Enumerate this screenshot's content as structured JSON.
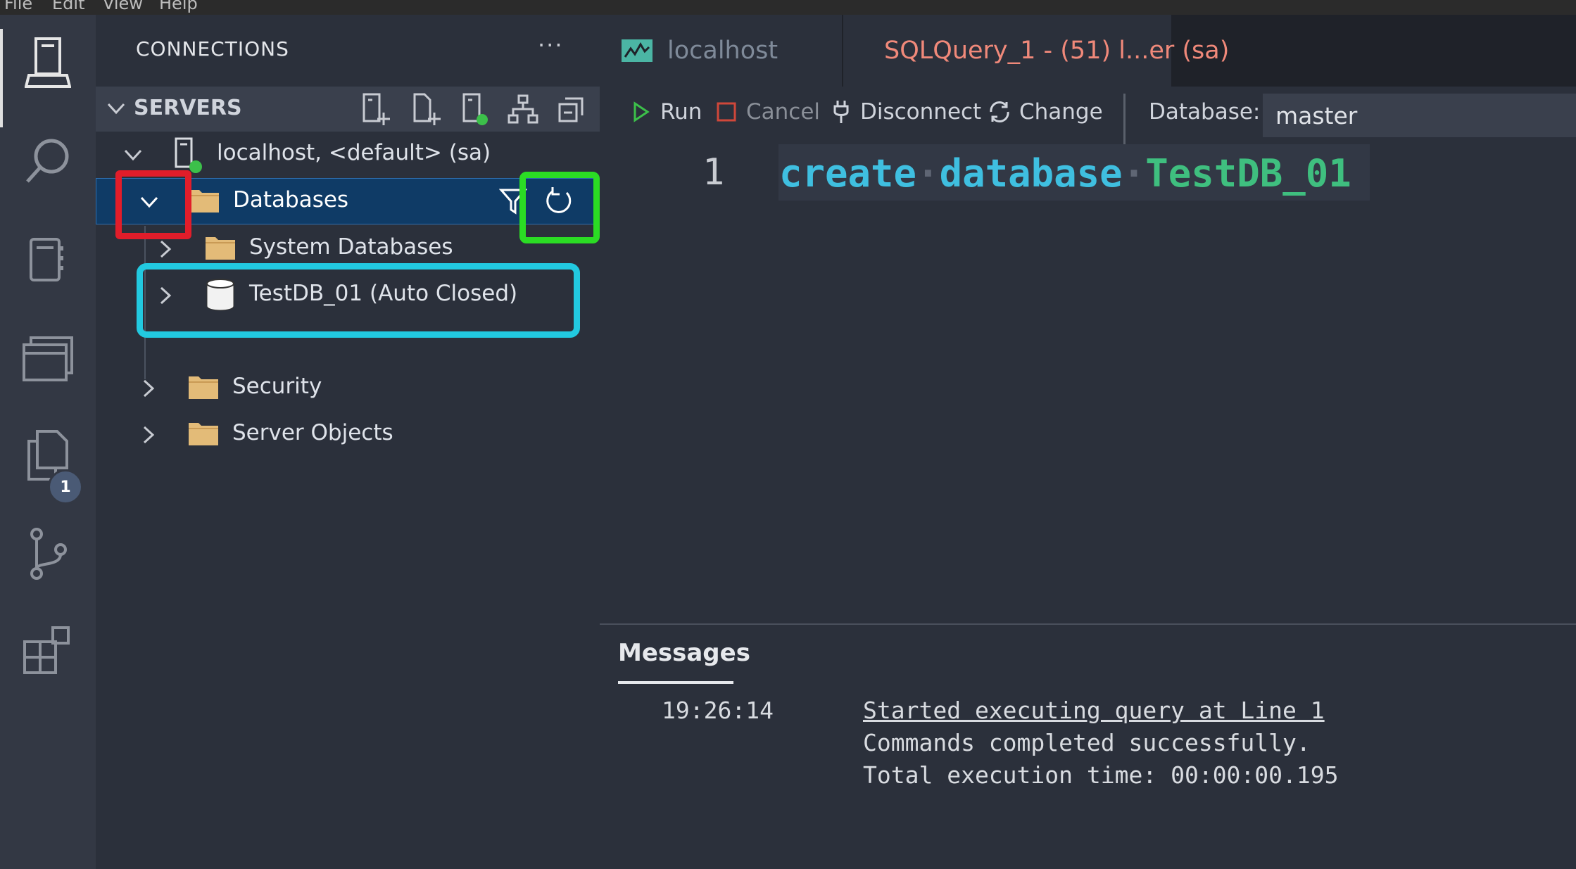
{
  "menu": {
    "items": [
      "File",
      "Edit",
      "View",
      "Help"
    ]
  },
  "activity_bar": {
    "badge_count": "1"
  },
  "sidebar": {
    "title": "CONNECTIONS",
    "more": "···",
    "servers_label": "SERVERS",
    "tree": {
      "server": "localhost, <default> (sa)",
      "databases": "Databases",
      "system_databases": "System Databases",
      "testdb": "TestDB_01 (Auto Closed)",
      "security": "Security",
      "server_objects": "Server Objects"
    }
  },
  "tabs": [
    {
      "label": "localhost",
      "color": "#7f8a99"
    },
    {
      "label": "SQLQuery_1 - (51) l...er (sa)",
      "color": "#f0897a",
      "dirty": true
    }
  ],
  "toolbar": {
    "run": "Run",
    "cancel": "Cancel",
    "disconnect": "Disconnect",
    "change": "Change",
    "database_label": "Database:",
    "database_value": "master"
  },
  "editor": {
    "line_number": "1",
    "code": {
      "kw1": "create",
      "kw2": "database",
      "name": "TestDB_01",
      "dot": "·"
    }
  },
  "messages": {
    "title": "Messages",
    "time": "19:26:14",
    "line1": "Started executing query at Line 1",
    "line2": "Commands completed successfully.",
    "line3": "Total execution time: 00:00:00.195"
  },
  "colors": {
    "annotation_red": "#e11d2a",
    "annotation_green": "#2bdc24",
    "annotation_cyan": "#22c9e0",
    "selection": "#0f3b66",
    "status_green": "#3cc04a"
  }
}
